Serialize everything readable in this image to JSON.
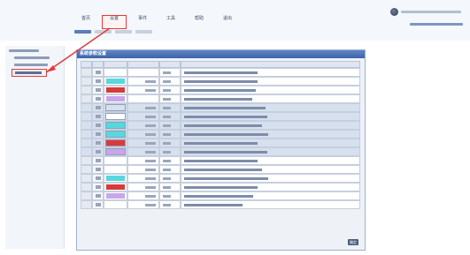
{
  "menu": {
    "items": [
      {
        "label": "首页",
        "sub": "",
        "active": false
      },
      {
        "label": "设置",
        "sub": "",
        "active": true
      },
      {
        "label": "事件",
        "sub": "",
        "active": false
      },
      {
        "label": "工具",
        "sub": "",
        "active": false
      },
      {
        "label": "帮助",
        "sub": "",
        "active": false
      },
      {
        "label": "退出",
        "sub": "",
        "active": false
      }
    ]
  },
  "panel": {
    "title": "系统参数设置",
    "columns": [
      "",
      "",
      "",
      "",
      ""
    ]
  },
  "rows": [
    {
      "band": false,
      "color": "#ffffff"
    },
    {
      "band": false,
      "color": "#56d8dc"
    },
    {
      "band": false,
      "color": "#d83a3a"
    },
    {
      "band": false,
      "color": "#c9a6e8"
    },
    {
      "band": true,
      "color": "#d6e0ee"
    },
    {
      "band": true,
      "color": "#ffffff"
    },
    {
      "band": true,
      "color": "#56d8dc"
    },
    {
      "band": true,
      "color": "#56d8dc"
    },
    {
      "band": true,
      "color": "#d83a3a"
    },
    {
      "band": true,
      "color": "#c9a6e8"
    },
    {
      "band": false,
      "color": "#ffffff"
    },
    {
      "band": false,
      "color": "#ffffff"
    },
    {
      "band": false,
      "color": "#56d8dc"
    },
    {
      "band": false,
      "color": "#d83a3a"
    },
    {
      "band": false,
      "color": "#c9a6e8"
    },
    {
      "band": false,
      "color": "#ffffff"
    }
  ],
  "footer": {
    "confirm_label": "确定"
  },
  "colors": {
    "accent_red": "#e23b3b",
    "header_blue": "#4a72b8"
  }
}
